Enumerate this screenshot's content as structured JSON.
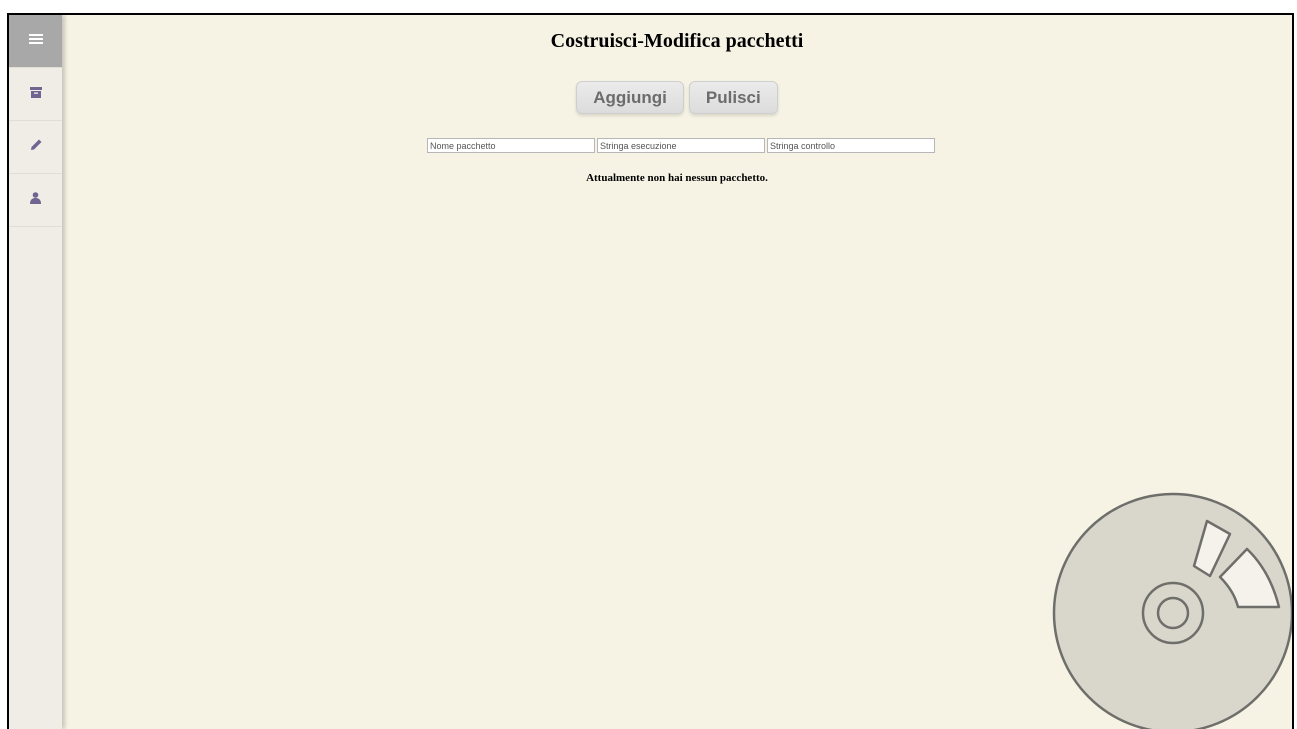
{
  "sidebar": {
    "items": [
      {
        "icon": "menu-icon",
        "active": true
      },
      {
        "icon": "archive-icon",
        "active": false
      },
      {
        "icon": "pencil-icon",
        "active": false
      },
      {
        "icon": "user-icon",
        "active": false
      }
    ],
    "icon_color": "#6e6591",
    "active_background": "#a8a8a8"
  },
  "main": {
    "title": "Costruisci-Modifica pacchetti",
    "buttons": {
      "add_label": "Aggiungi",
      "clear_label": "Pulisci"
    },
    "inputs": {
      "name_placeholder": "Nome pacchetto",
      "exec_placeholder": "Stringa esecuzione",
      "check_placeholder": "Stringa controllo"
    },
    "empty_message": "Attualmente non hai nessun pacchetto."
  },
  "decoration": {
    "icon": "disc-icon"
  },
  "colors": {
    "background": "#f6f3e4",
    "sidebar": "#f0ede6",
    "disc_fill": "#d9d7cb",
    "disc_stroke": "#6e6e6a"
  }
}
